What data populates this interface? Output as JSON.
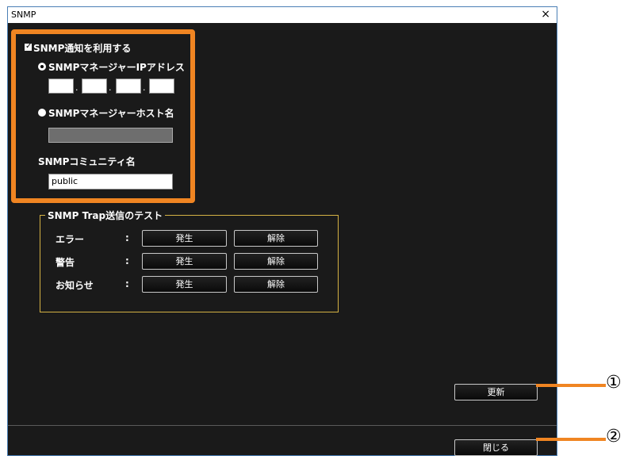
{
  "window": {
    "title": "SNMP",
    "close_glyph": "×"
  },
  "snmp": {
    "enable_label": "SNMP通知を利用する",
    "enable_checked": true,
    "ip_option_label": "SNMPマネージャーIPアドレス",
    "ip_dot": ".",
    "host_option_label": "SNMPマネージャーホスト名",
    "community_label": "SNMPコミュニティ名",
    "community_value": "public"
  },
  "trap_test": {
    "title": "SNMP Trap送信のテスト",
    "colon": ":",
    "rows": [
      {
        "label": "エラー",
        "send": "発生",
        "clear": "解除"
      },
      {
        "label": "警告",
        "send": "発生",
        "clear": "解除"
      },
      {
        "label": "お知らせ",
        "send": "発生",
        "clear": "解除"
      }
    ]
  },
  "buttons": {
    "update": "更新",
    "close": "閉じる"
  },
  "callouts": {
    "one": "①",
    "two": "②"
  },
  "colors": {
    "highlight": "#f08522",
    "group_border": "#d4b144",
    "background": "#1a1a1a"
  }
}
